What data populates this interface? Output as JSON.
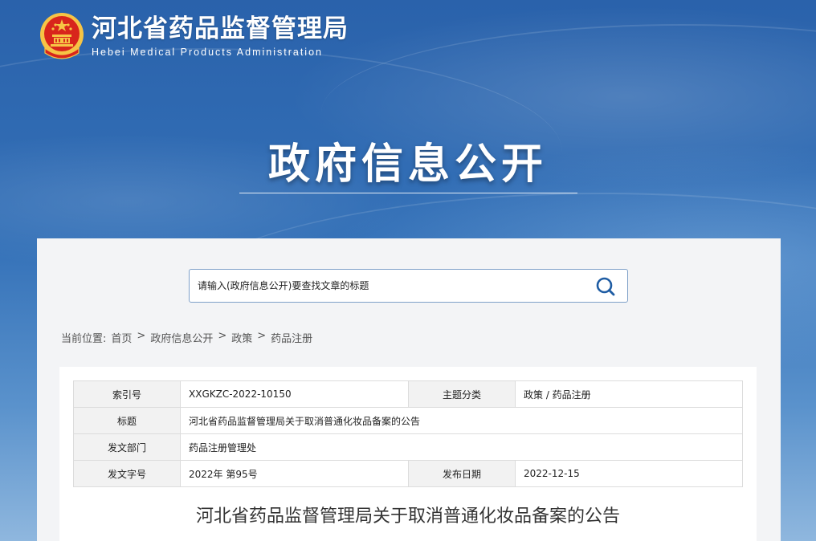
{
  "header": {
    "org_name_cn": "河北省药品监督管理局",
    "org_name_en": "Hebei Medical Products Administration",
    "hero_title": "政府信息公开",
    "emblem_icon": "national-emblem-icon"
  },
  "search": {
    "placeholder": "请输入(政府信息公开)要查找文章的标题",
    "icon": "search-icon"
  },
  "breadcrumb": {
    "prefix": "当前位置:",
    "items": [
      "首页",
      "政府信息公开",
      "政策",
      "药品注册"
    ],
    "separator": ">"
  },
  "meta_table": {
    "index_label": "索引号",
    "index_value": "XXGKZC-2022-10150",
    "topic_label": "主题分类",
    "topic_value": "政策 / 药品注册",
    "title_label": "标题",
    "title_value": "河北省药品监督管理局关于取消普通化妆品备案的公告",
    "dept_label": "发文部门",
    "dept_value": "药品注册管理处",
    "docno_label": "发文字号",
    "docno_value": "2022年 第95号",
    "date_label": "发布日期",
    "date_value": "2022-12-15"
  },
  "article": {
    "title": "河北省药品监督管理局关于取消普通化妆品备案的公告"
  },
  "colors": {
    "banner": "#2c65ad",
    "panel": "#f3f4f6",
    "search_border": "#7ea0c8",
    "emblem_red": "#d8251c",
    "emblem_gold": "#f6c445"
  }
}
